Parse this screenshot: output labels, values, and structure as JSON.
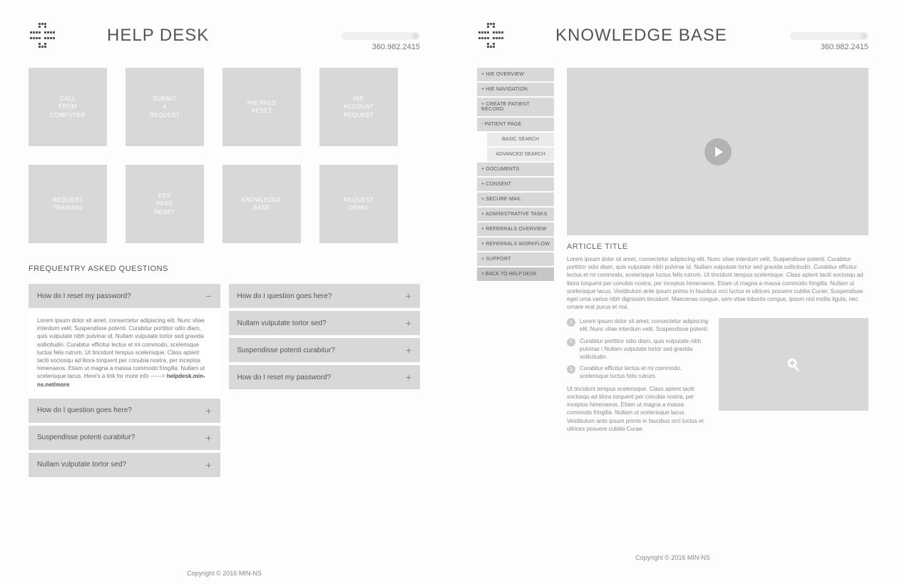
{
  "left": {
    "title": "HELP DESK",
    "phone": "360.982.2415",
    "tiles": [
      "CALL\nFROM\nCOMPUTER",
      "SUBMIT\nA\nREQUEST",
      "HIE PASS\nRESET",
      "HIE\nACCOUNT\nREQUEST",
      "REQUEST\nTRAINING",
      "REF\nPASS\nRESET",
      "KNOWLEDGE\nBASE",
      "REQUEST\nDEMO"
    ],
    "faq_title": "FREQUENTRY ASKED QUESTIONS",
    "faq_left": [
      "How do I reset my password?",
      "How do I question goes here?",
      "Suspendisse potenti curabitur?",
      "Nullam vulputate tortor sed?"
    ],
    "faq_left_body": "Lorem ipsum dolor sit amet, consectetur adipiscing elit. Nunc vitae interdum velit. Suspendisse potenti. Curabitur porttitor odio diam, quis vulputate nibh pulvinar id. Nullam vulputate tortor sed gravida sollicitudin. Curabitur efficitur lectus et mi commodo, scelerisque luctus felis rutrum. Ut tincidunt tempus scelerisque. Class aptent taciti sociosqu ad litora torquent per conubia nostra, per inceptos himenaeos. Etiam ut magna a massa commodo fringilla. Nullam ut scelerisque lacus.",
    "faq_left_linkintro": "Here's a link for more info ------>",
    "faq_left_link": "helpdesk.min-ns.net/more",
    "faq_right": [
      "How do I question goes here?",
      "Nullam vulputate tortor sed?",
      "Suspendisse potenti curabitur?",
      "How do I reset my password?"
    ],
    "footer": "Copyright © 2016 MIN-NS"
  },
  "right": {
    "title": "KNOWLEDGE BASE",
    "phone": "360.982.2415",
    "sidebar": [
      "+ HIE OVERVIEW",
      "+ HIE NAVIGATION",
      "+ CREATE PATIENT RECORD",
      "- PATIENT PAGE"
    ],
    "sidebar_sub": [
      "BASIC SEARCH",
      "ADVANCED SEARCH"
    ],
    "sidebar2": [
      "+ DOCUMENTS",
      "+ CONSENT",
      "+ SECURE MAIL",
      "+ ADMINISTRATIVE TASKS",
      "+ REFERRALS OVERVIEW",
      "+ REFERRALS WORKFLOW",
      "+ SUPPORT"
    ],
    "sidebar_back": "< BACK TO HELP DESK",
    "article_title": "ARTICLE TITLE",
    "article_p1": "Lorem ipsum dolor sit amet, consectetur adipiscing elit. Nunc vitae interdum velit. Suspendisse potenti. Curabitur porttitor odio diam, quis vulputate nibh pulvinar id. Nullam vulputate tortor sed gravida sollicitudin. Curabitur efficitur lectus et mi commodo, scelerisque luctus felis rutrum. Ut tincidunt tempus scelerisque. Class aptent taciti sociosqu ad litora torquent per conubia nostra, per inceptos himenaeos. Etiam ut magna a massa commodo fringilla. Nullam ut scelerisque lacus. Vestibulum ante ipsum primis in faucibus orci luctus et ultrices posuere cubilia Curae; Suspendisse eget urna varius nibh dignissim tincidunt. Maecenas congue, sem vitae lobortis congue, ipsum nisl mollis ligula, nec ornare erat purus et nisi.",
    "steps": [
      "Lorem ipsum dolor sit amet, consectetur adipiscing elit. Nunc vitae interdum velit. Suspendisse potenti.",
      "Curabitur porttitor odio diam, quis vulputate nibh pulvinar i Nullam vulputate tortor sed gravida sollicitudin.",
      "Curabitur efficitur lectus et mi commodo, scelerisque luctus felis rutrum."
    ],
    "article_p2": "Ut tincidunt tempus scelerisque. Class aptent taciti sociosqu ad litora torquent per conubia nostra, per inceptos himenaeos. Etiam ut magna a massa commodo fringilla. Nullam ut scelerisque lacus. Vestibulum ante ipsum primis in faucibus orci luctus et ultrices posuere cubilia Curae.",
    "footer": "Copyright © 2016 MIN-NS"
  }
}
